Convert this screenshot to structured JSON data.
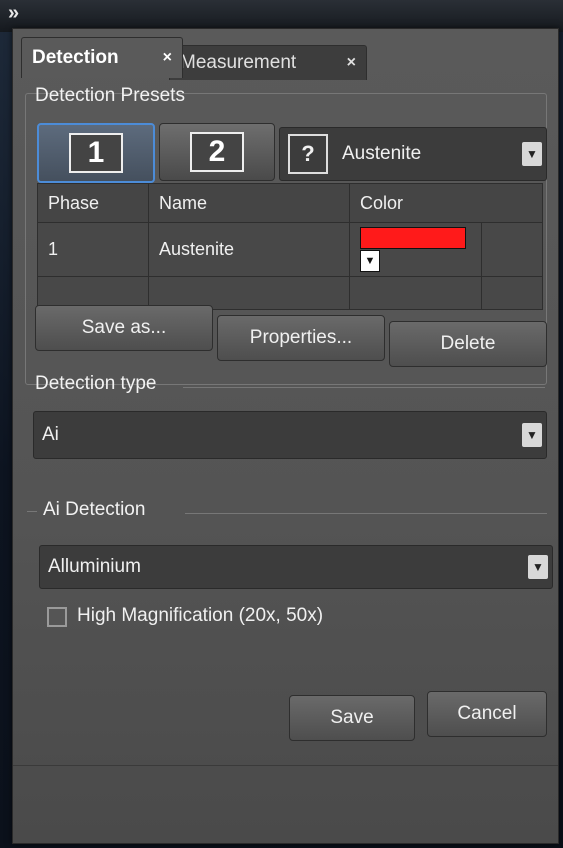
{
  "window": {
    "expand_icon": "double-chevron-right-icon",
    "close_glyph": "×"
  },
  "tabs": [
    {
      "label": "Detection",
      "close": "×"
    },
    {
      "label": "Measurement",
      "close": "×"
    }
  ],
  "presets": {
    "title": "Detection Presets",
    "buttons": [
      {
        "label": "1"
      },
      {
        "label": "2"
      }
    ],
    "selected_icon": "?",
    "selected_value": "Austenite"
  },
  "phase_table": {
    "headers": [
      "Phase",
      "Name",
      "Color"
    ],
    "rows": [
      {
        "phase": "1",
        "name": "Austenite",
        "color": "#ff1a1a"
      }
    ]
  },
  "preset_actions": {
    "save_as": "Save as...",
    "properties": "Properties...",
    "delete": "Delete"
  },
  "detection_type": {
    "title": "Detection type",
    "value": "Ai"
  },
  "ai_detection": {
    "title": "Ai Detection",
    "value": "Alluminium",
    "high_mag_label": "High Magnification (20x, 50x)",
    "high_mag_checked": false
  },
  "footer": {
    "save": "Save",
    "cancel": "Cancel"
  }
}
